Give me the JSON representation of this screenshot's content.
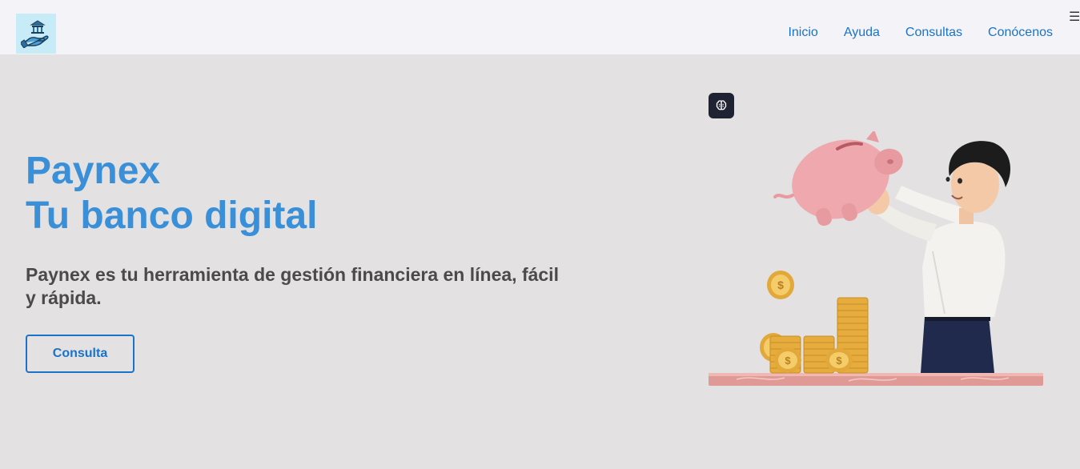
{
  "header": {
    "logo_icon": "bank-in-hand-icon",
    "nav": [
      {
        "label": "Inicio"
      },
      {
        "label": "Ayuda"
      },
      {
        "label": "Consultas"
      },
      {
        "label": "Conócenos"
      }
    ],
    "menu_icon": "☰"
  },
  "hero": {
    "title_line1": "Paynex",
    "title_line2": "Tu banco digital",
    "description": "Paynex es tu herramienta de gestión financiera en línea, fácil y rápida.",
    "cta_label": "Consulta",
    "badge_icon": "brain-icon",
    "illustration": "man-holding-piggy-bank-with-coins"
  },
  "colors": {
    "brand_blue": "#3a8fd9",
    "link_blue": "#1a73c8",
    "hero_bg": "#e3e1e2",
    "nav_bg": "#f4f4f8"
  }
}
